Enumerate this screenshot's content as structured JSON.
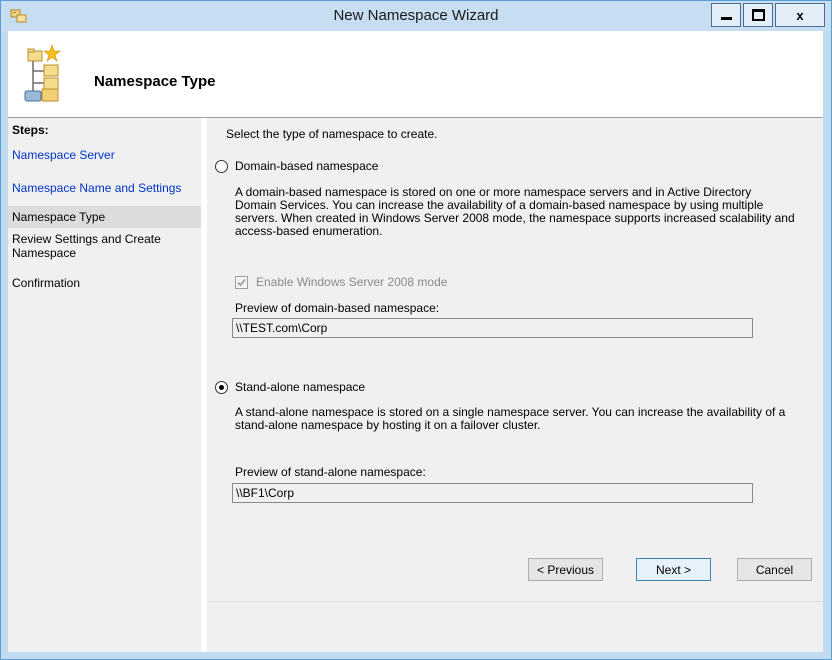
{
  "window": {
    "title": "New Namespace Wizard",
    "icon": "wizard-app-icon"
  },
  "header": {
    "title": "Namespace Type",
    "icon": "namespace-tree-icon"
  },
  "steps": {
    "heading": "Steps:",
    "items": [
      {
        "label": "Namespace Server",
        "state": "done"
      },
      {
        "label": "Namespace Name and Settings",
        "state": "done"
      },
      {
        "label": "Namespace Type",
        "state": "current"
      },
      {
        "label": "Review Settings and Create Namespace",
        "state": "pending"
      },
      {
        "label": "Confirmation",
        "state": "pending"
      }
    ]
  },
  "content": {
    "instruction": "Select the type of namespace to create.",
    "domain_based": {
      "label": "Domain-based namespace",
      "selected": false,
      "description": "A domain-based namespace is stored on one or more namespace servers and in Active Directory Domain Services. You can increase the availability of a domain-based namespace by using multiple servers. When created in Windows Server 2008 mode, the namespace supports increased scalability and access-based enumeration.",
      "checkbox_label": "Enable Windows Server 2008 mode",
      "checkbox_checked": true,
      "preview_label": "Preview of domain-based namespace:",
      "preview_value": "\\\\TEST.com\\Corp"
    },
    "standalone": {
      "label": "Stand-alone namespace",
      "selected": true,
      "description": "A stand-alone namespace is stored on a single namespace server. You can increase the availability of a stand-alone namespace by hosting it on a failover cluster.",
      "preview_label": "Preview of stand-alone namespace:",
      "preview_value": "\\\\BF1\\Corp"
    }
  },
  "buttons": {
    "previous": "< Previous",
    "next": "Next >",
    "cancel": "Cancel"
  },
  "colors": {
    "title_bar": "#c7def2",
    "link": "#0033cc",
    "pane_background": "#f0f0f0"
  }
}
